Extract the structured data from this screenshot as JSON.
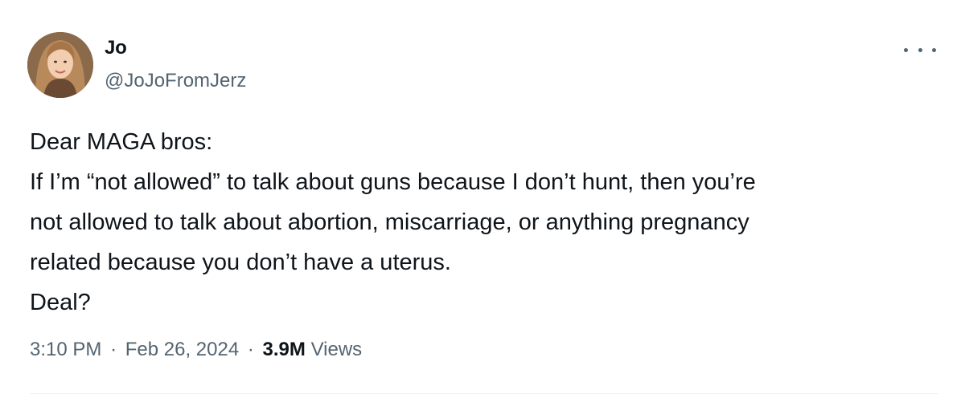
{
  "tweet": {
    "author": {
      "name": "Jo",
      "handle": "@JoJoFromJerz"
    },
    "more_icon": "more-horizontal-icon",
    "lines": [
      "Dear MAGA bros:",
      "If I’m “not allowed” to talk about guns because I don’t hunt, then you’re",
      "not allowed to talk about abortion, miscarriage, or anything pregnancy",
      "related because you don’t have a uterus.",
      "Deal?"
    ],
    "time": "3:10 PM",
    "date": "Feb 26, 2024",
    "separator": "·",
    "views_count": "3.9M",
    "views_label": "Views"
  },
  "colors": {
    "text_primary": "#0f1419",
    "text_secondary": "#536471",
    "divider": "#eff3f4"
  }
}
